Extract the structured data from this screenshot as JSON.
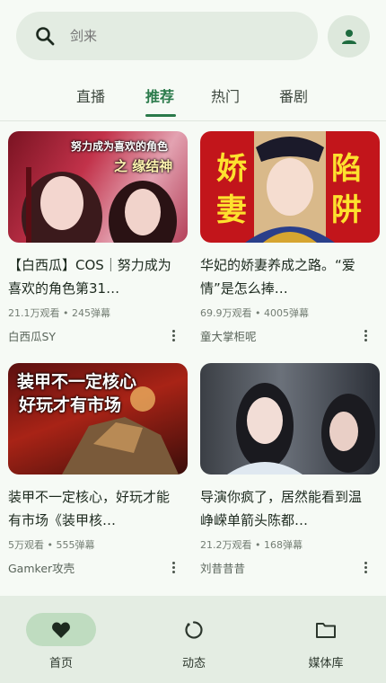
{
  "search": {
    "placeholder": "剑来"
  },
  "tabs": [
    {
      "label": "直播"
    },
    {
      "label": "推荐"
    },
    {
      "label": "热门"
    },
    {
      "label": "番剧"
    }
  ],
  "videos": [
    {
      "title": "【白西瓜】COS｜努力成为喜欢的角色第31…",
      "meta": "21.1万观看 • 245弹幕",
      "author": "白西瓜SY",
      "thumb_text_1": "努力成为喜欢的角色",
      "thumb_text_2": "之 缘结神"
    },
    {
      "title": "华妃的娇妻养成之路。“爱情”是怎么捧…",
      "meta": "69.9万观看 • 4005弹幕",
      "author": "童大掌柜呢",
      "thumb_text_1": "娇",
      "thumb_text_2": "陷",
      "thumb_text_3": "妻",
      "thumb_text_4": "阱"
    },
    {
      "title": "装甲不一定核心，好玩才能有市场《装甲核…",
      "meta": "5万观看 • 555弹幕",
      "author": "Gamker攻壳",
      "thumb_text_1": "装甲不一定核心",
      "thumb_text_2": "好玩才有市场"
    },
    {
      "title": "导演你疯了，居然能看到温峥嵘单箭头陈都…",
      "meta": "21.2万观看 • 168弹幕",
      "author": "刘昔昔昔"
    }
  ],
  "bottom_nav": [
    {
      "label": "首页",
      "icon": "heart-icon"
    },
    {
      "label": "动态",
      "icon": "refresh-circle-icon"
    },
    {
      "label": "媒体库",
      "icon": "folder-icon"
    }
  ],
  "colors": {
    "accent": "#2a7a4a",
    "background": "#f6faf5",
    "nav_bg": "#e4ede3"
  }
}
